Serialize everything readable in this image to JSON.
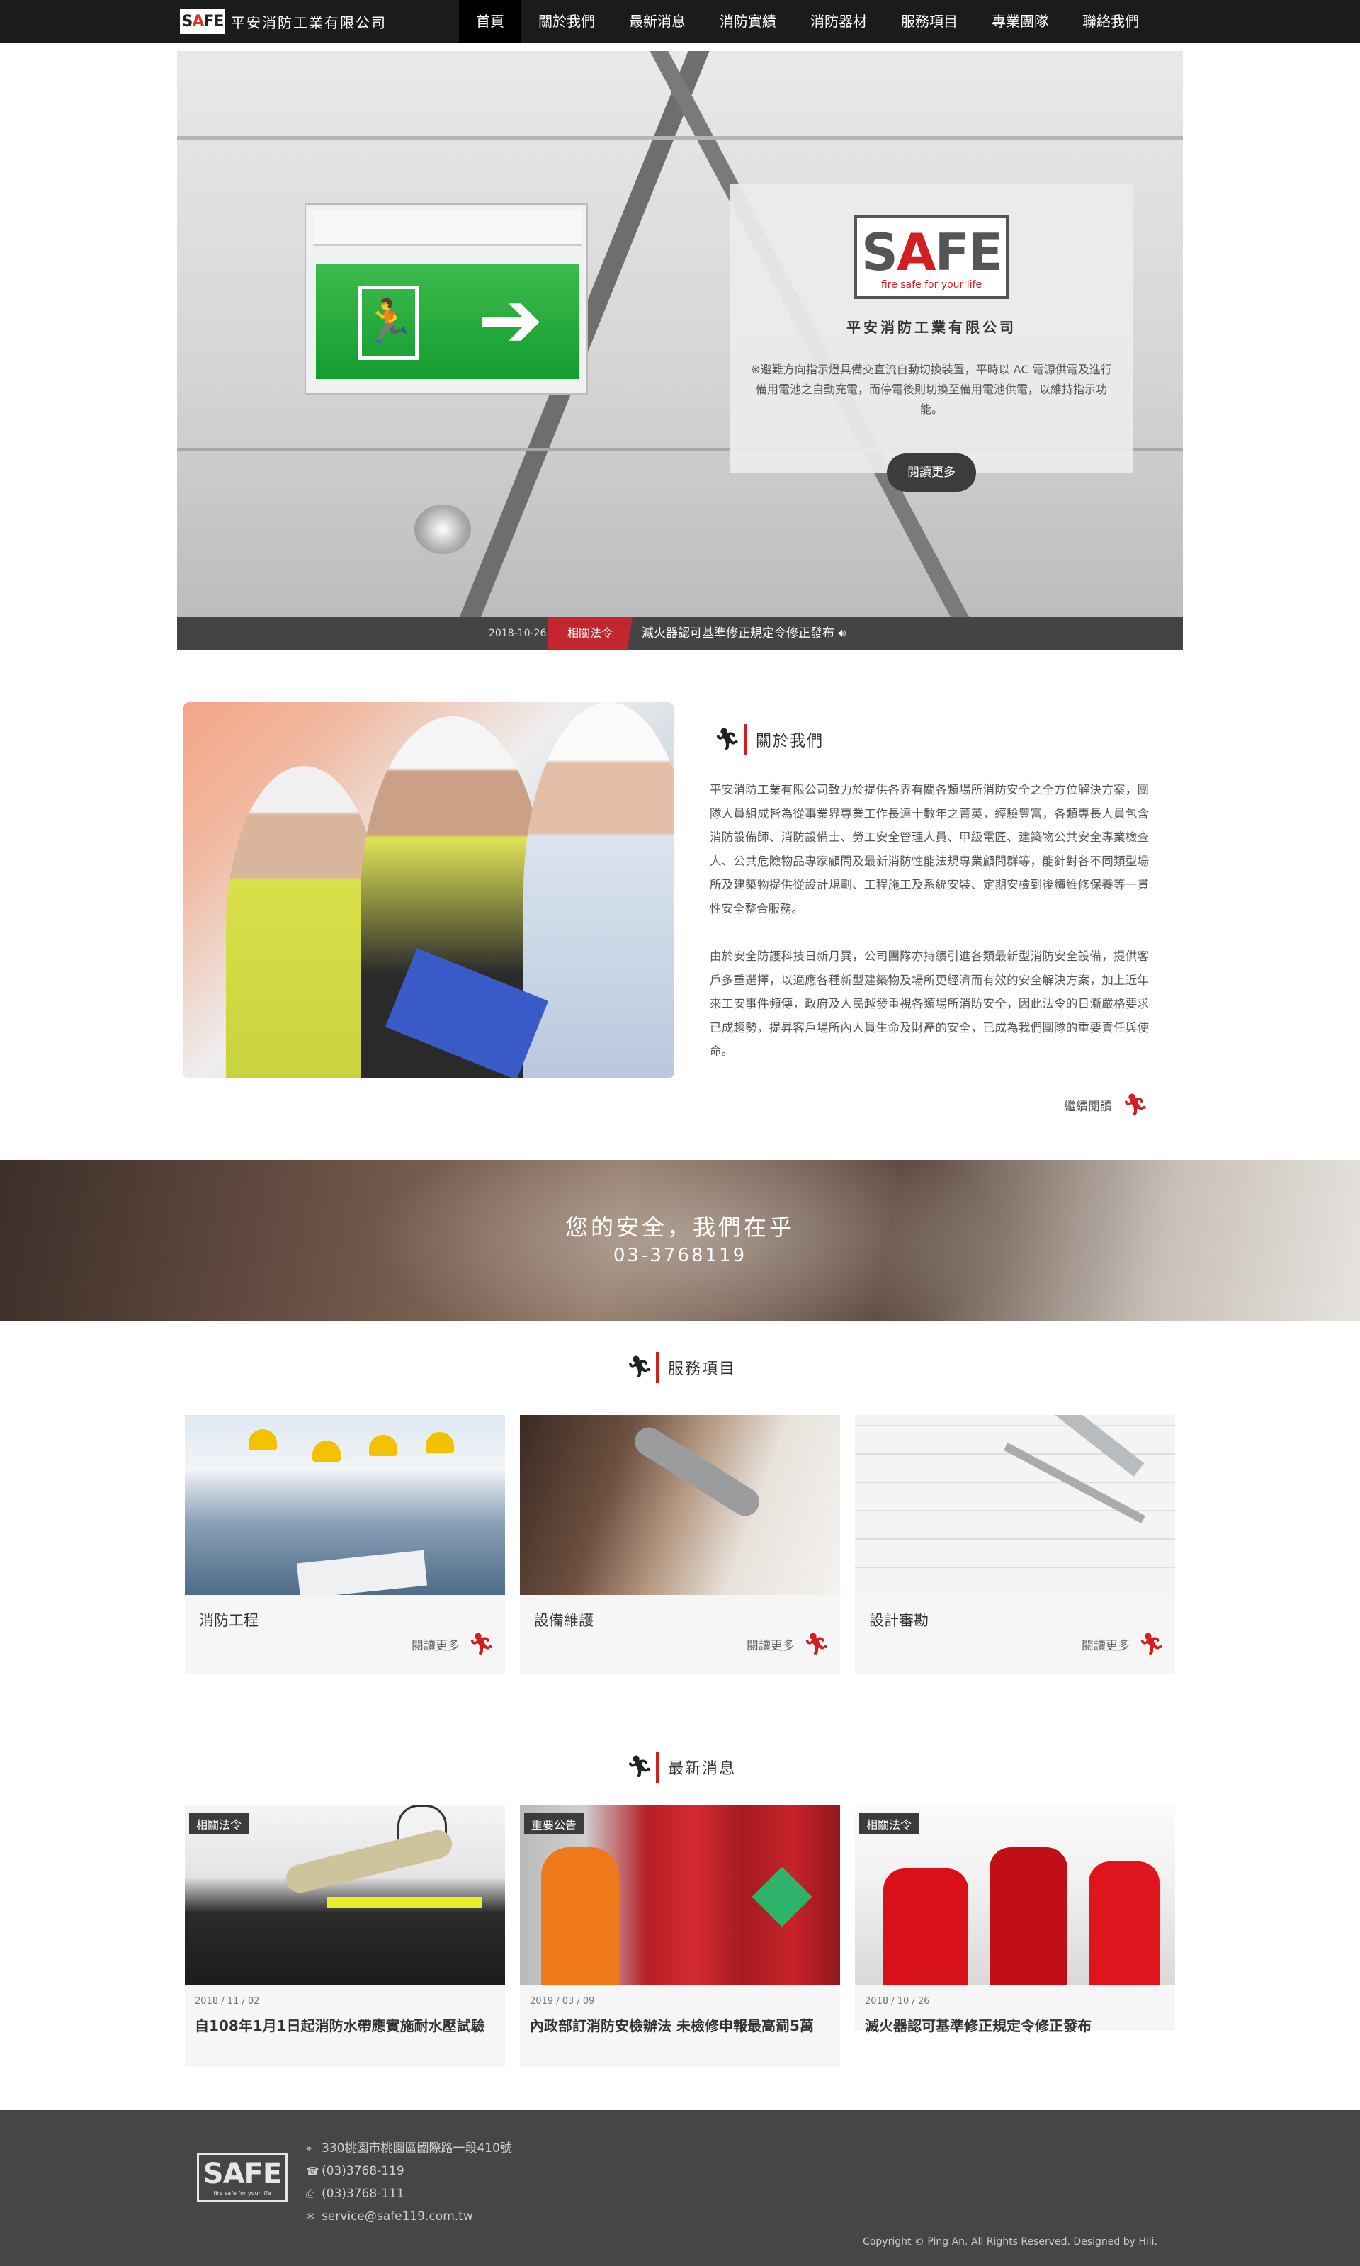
{
  "nav": {
    "logo_text": "SAFE",
    "company_name": "平安消防工業有限公司",
    "items": [
      {
        "label": "首頁",
        "active": true
      },
      {
        "label": "關於我們"
      },
      {
        "label": "最新消息"
      },
      {
        "label": "消防實績"
      },
      {
        "label": "消防器材"
      },
      {
        "label": "服務項目"
      },
      {
        "label": "專業團隊"
      },
      {
        "label": "聯絡我們"
      }
    ]
  },
  "hero": {
    "logo_text": "SAFE",
    "logo_tagline": "fire safe for your life",
    "title": "平安消防工業有限公司",
    "description": "※避難方向指示燈具備交直流自動切換裝置，平時以 AC 電源供電及進行備用電池之自動充電，而停電後則切換至備用電池供電，以維持指示功能。",
    "button": "閱讀更多"
  },
  "ticker": {
    "date": "2018-10-26",
    "tag": "相關法令",
    "text": "滅火器認可基準修正規定令修正發布"
  },
  "about": {
    "title": "關於我們",
    "paragraph1": "平安消防工業有限公司致力於提供各界有關各類場所消防安全之全方位解決方案，團隊人員組成皆為從事業界專業工作長達十數年之菁英，經驗豐富，各類專長人員包含消防設備師、消防設備士、勞工安全管理人員、甲級電匠、建築物公共安全專業檢查人、公共危險物品專家顧問及最新消防性能法規專業顧問群等，能針對各不同類型場所及建築物提供從設計規劃、工程施工及系統安裝、定期安檢到後續維修保養等一貫性安全整合服務。",
    "paragraph2": "由於安全防護科技日新月異，公司團隊亦持續引進各類最新型消防安全設備，提供客戶多重選擇，以適應各種新型建築物及場所更經濟而有效的安全解決方案，加上近年來工安事件頻傳，政府及人民越發重視各類場所消防安全，因此法令的日漸嚴格要求已成趨勢，提昇客戶場所內人員生命及財產的安全，已成為我們團隊的重要責任與使命。",
    "more": "繼續閱讀"
  },
  "banner": {
    "slogan": "您的安全，我們在乎",
    "phone": "03-3768119"
  },
  "services": {
    "title": "服務項目",
    "items": [
      {
        "title": "消防工程",
        "more": "閱讀更多"
      },
      {
        "title": "設備維護",
        "more": "閱讀更多"
      },
      {
        "title": "設計審勘",
        "more": "閱讀更多"
      }
    ]
  },
  "news": {
    "title": "最新消息",
    "items": [
      {
        "badge": "相關法令",
        "date": "2018 / 11 / 02",
        "title": "自108年1月1日起消防水帶應實施耐水壓試驗"
      },
      {
        "badge": "重要公告",
        "date": "2019 / 03 / 09",
        "title": "內政部訂消防安檢辦法 未檢修申報最高罰5萬"
      },
      {
        "badge": "相關法令",
        "date": "2018 / 10 / 26",
        "title": "滅火器認可基準修正規定令修正發布"
      }
    ]
  },
  "footer": {
    "logo_text": "SAFE",
    "logo_tagline": "fire safe for your life",
    "address": "330桃園市桃園區國際路一段410號",
    "phone": "(03)3768-119",
    "fax": "(03)3768-111",
    "email": "service@safe119.com.tw",
    "copyright": "Copyright © Ping An. All Rights Reserved. Designed by Hiii."
  },
  "colors": {
    "accent_red": "#d21f22",
    "nav_bg": "#1b1b1b",
    "footer_bg": "#464646"
  }
}
